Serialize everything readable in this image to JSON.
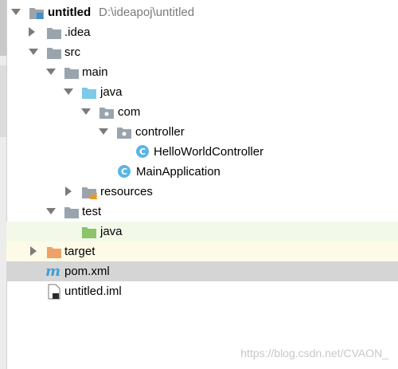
{
  "project": {
    "name": "untitled",
    "path": "D:\\ideapoj\\untitled"
  },
  "tree": {
    "idea": ".idea",
    "src": "src",
    "main": "main",
    "java": "java",
    "com": "com",
    "controller": "controller",
    "hello_controller": "HelloWorldController",
    "main_application": "MainApplication",
    "resources": "resources",
    "test": "test",
    "test_java": "java",
    "target": "target",
    "pom": "pom.xml",
    "iml": "untitled.iml"
  },
  "watermark": "https://blog.csdn.net/CVAON_",
  "colors": {
    "folder_gray": "#9aa4ad",
    "source_blue": "#7cc9ea",
    "test_green": "#8bc46a",
    "excluded_orange": "#f0a167",
    "class_circle": "#5ab5e5",
    "selection": "#d5d5d5"
  }
}
